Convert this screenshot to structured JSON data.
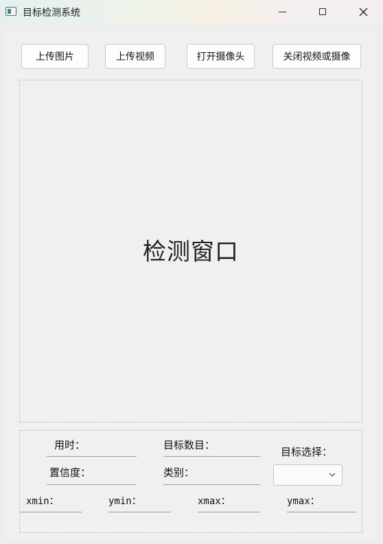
{
  "window": {
    "title": "目标检测系统",
    "controls": {
      "minimize_icon": "minimize-icon",
      "maximize_icon": "maximize-icon",
      "close_icon": "close-icon"
    }
  },
  "toolbar": {
    "upload_image": "上传图片",
    "upload_video": "上传视频",
    "open_camera": "打开摄像头",
    "close_video_or_camera": "关闭视频或摄像"
  },
  "display": {
    "placeholder": "检测窗口"
  },
  "info": {
    "time_label": "用时：",
    "time_value": "",
    "target_count_label": "目标数目：",
    "target_count_value": "",
    "target_select_label": "目标选择：",
    "target_select_value": "",
    "confidence_label": "置信度：",
    "confidence_value": "",
    "class_label": "类别：",
    "class_value": "",
    "xmin_label": "xmin：",
    "xmin_value": "",
    "ymin_label": "ymin：",
    "ymin_value": "",
    "xmax_label": "xmax：",
    "xmax_value": "",
    "ymax_label": "ymax：",
    "ymax_value": ""
  },
  "colors": {
    "window_bg": "#ededed",
    "panel_border": "#b5b5b5",
    "button_bg": "#fdfdfd",
    "text": "#1a1a1a"
  }
}
